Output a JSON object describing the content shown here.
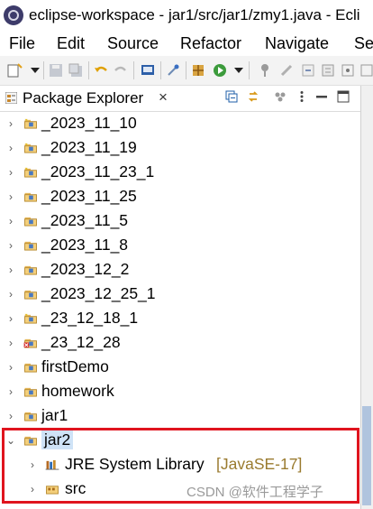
{
  "window": {
    "title": "eclipse-workspace - jar1/src/jar1/zmy1.java - Ecli"
  },
  "menu": {
    "items": [
      "File",
      "Edit",
      "Source",
      "Refactor",
      "Navigate",
      "Se"
    ]
  },
  "panel": {
    "title": "Package Explorer",
    "close": "×"
  },
  "tree": {
    "items": [
      {
        "label": "_2023_11_10"
      },
      {
        "label": "_2023_11_19"
      },
      {
        "label": "_2023_11_23_1"
      },
      {
        "label": "_2023_11_25"
      },
      {
        "label": "_2023_11_5"
      },
      {
        "label": "_2023_11_8"
      },
      {
        "label": "_2023_12_2"
      },
      {
        "label": "_2023_12_25_1"
      },
      {
        "label": "_23_12_18_1"
      },
      {
        "label": "_23_12_28"
      },
      {
        "label": "firstDemo"
      },
      {
        "label": "homework"
      },
      {
        "label": "jar1"
      },
      {
        "label": "jar2"
      }
    ],
    "children": [
      {
        "label": "JRE System Library",
        "decoration": "[JavaSE-17]"
      },
      {
        "label": "src"
      }
    ]
  },
  "watermark": "CSDN @软件工程学子",
  "colors": {
    "selection": "#cfe3f7",
    "highlight": "#e0141e"
  }
}
